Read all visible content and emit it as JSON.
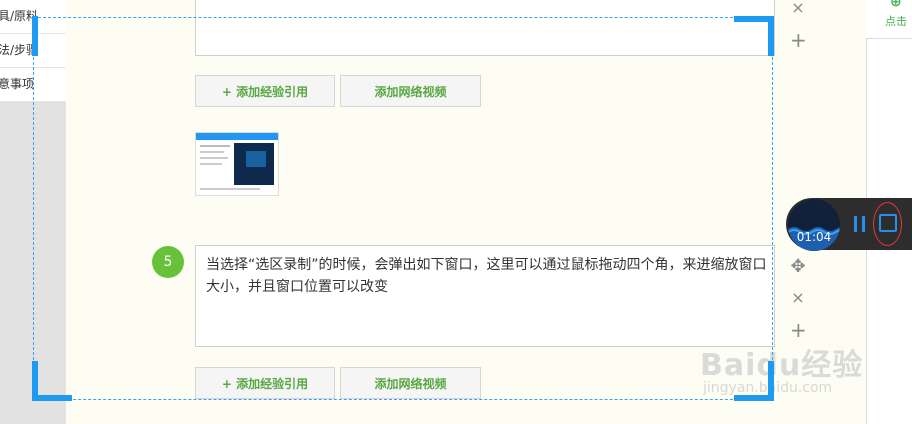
{
  "sidebar": {
    "items": [
      {
        "label": "具/原料"
      },
      {
        "label": "法/步骤"
      },
      {
        "label": "意事项"
      }
    ]
  },
  "editor": {
    "add_experience_ref_label": "+ 添加经验引用",
    "add_video_label": "添加网络视频",
    "step5": {
      "number": "5",
      "text": "当选择“选区录制”的时候，会弹出如下窗口，这里可以通过鼠标拖动四个角，来进缩放窗口大小，并且窗口位置可以改变"
    }
  },
  "right_panel": {
    "label": "点击",
    "plus_icon": "plus-icon"
  },
  "controls": {
    "close_glyph": "×",
    "add_glyph": "+",
    "move_glyph": "✥"
  },
  "recorder": {
    "time": "01:04",
    "accent_color": "#2b8cf0"
  },
  "selection_frame": {
    "color": "#1e9bf0"
  },
  "watermark": {
    "brand": "Baidu经验",
    "url": "jingyan.baidu.com"
  }
}
